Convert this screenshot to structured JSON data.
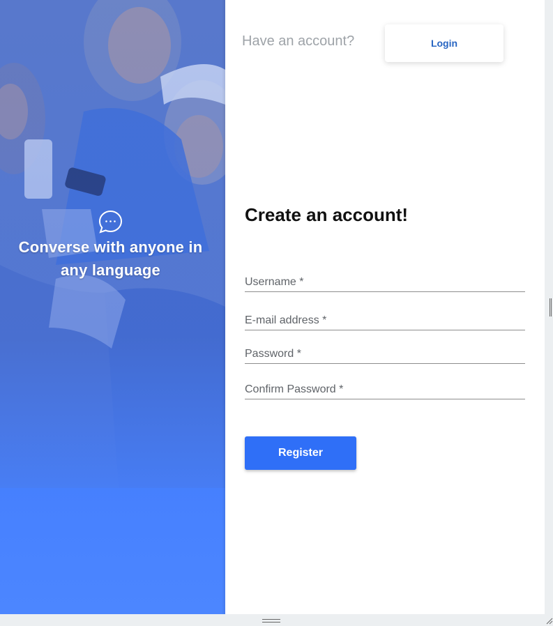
{
  "hero": {
    "tagline": "Converse with anyone in any language",
    "icon": "chat-bubble-icon"
  },
  "header": {
    "have_account_text": "Have an account?",
    "login_label": "Login"
  },
  "form": {
    "title": "Create an account!",
    "fields": [
      {
        "label": "Username *",
        "value": ""
      },
      {
        "label": "E-mail address *",
        "value": ""
      },
      {
        "label": "Password *",
        "value": ""
      },
      {
        "label": "Confirm Password *",
        "value": ""
      }
    ],
    "register_label": "Register"
  },
  "colors": {
    "accent": "#2f6ff7",
    "hero_blue": "#4a86ff",
    "login_text": "#2765c2"
  }
}
